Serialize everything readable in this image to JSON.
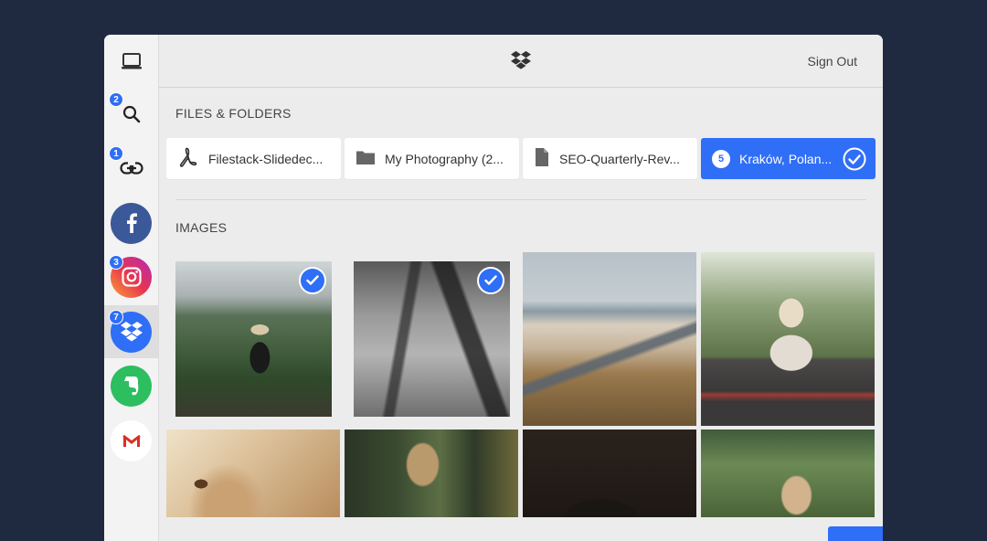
{
  "header": {
    "sign_out": "Sign Out"
  },
  "sidebar": {
    "items": [
      {
        "name": "local-computer",
        "icon": "laptop-icon"
      },
      {
        "name": "search",
        "icon": "search-icon",
        "badge": "2"
      },
      {
        "name": "link",
        "icon": "link-icon",
        "badge": "1"
      },
      {
        "name": "facebook",
        "icon": "facebook-icon",
        "color": "#3b5998"
      },
      {
        "name": "instagram",
        "icon": "instagram-icon",
        "badge": "3"
      },
      {
        "name": "dropbox",
        "icon": "dropbox-icon",
        "badge": "7",
        "color": "#2f6ef6",
        "active": true
      },
      {
        "name": "evernote",
        "icon": "evernote-icon",
        "color": "#2dbe60"
      },
      {
        "name": "gmail",
        "icon": "gmail-icon"
      }
    ]
  },
  "sections": {
    "files_title": "FILES & FOLDERS",
    "images_title": "IMAGES"
  },
  "files": [
    {
      "label": "Filestack-Slidedec...",
      "icon": "pdf-icon"
    },
    {
      "label": "My Photography (2...",
      "icon": "folder-icon"
    },
    {
      "label": "SEO-Quarterly-Rev...",
      "icon": "document-icon"
    },
    {
      "label": "Kraków, Polan...",
      "icon": "folder-icon",
      "count": "5",
      "selected": true
    }
  ],
  "images": [
    {
      "subject": "greenhouse-portrait",
      "selected": true
    },
    {
      "subject": "misty-forest",
      "selected": true
    },
    {
      "subject": "beach-boardwalk",
      "selected": false
    },
    {
      "subject": "woman-with-blanket",
      "selected": false
    },
    {
      "subject": "fluffy-dog",
      "selected": false
    },
    {
      "subject": "sitting-woman",
      "selected": false
    },
    {
      "subject": "dark-dog",
      "selected": false
    },
    {
      "subject": "woman-in-plants",
      "selected": false
    }
  ],
  "colors": {
    "accent": "#2f6ef6",
    "background": "#1f2a40"
  }
}
